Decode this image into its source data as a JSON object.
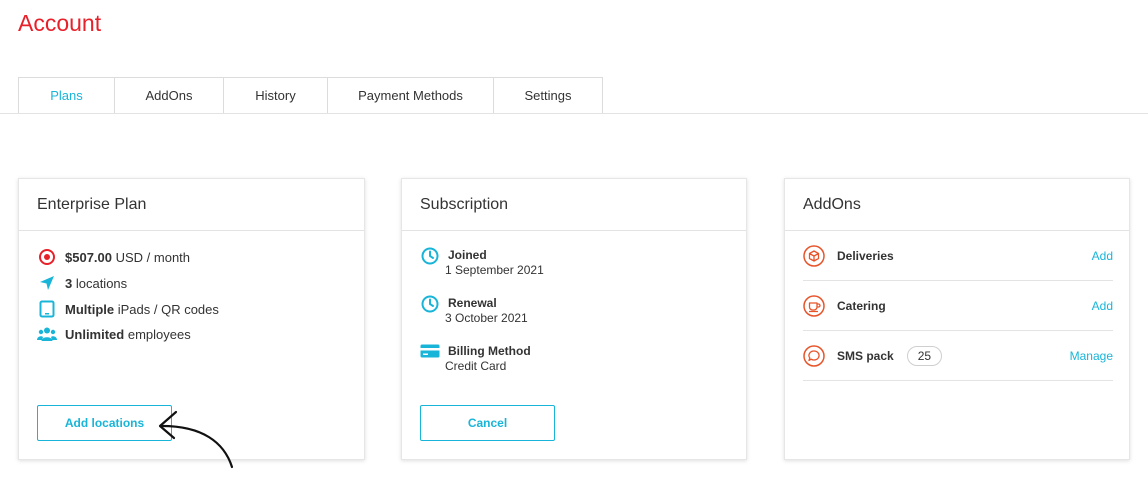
{
  "page": {
    "title": "Account"
  },
  "tabs": [
    {
      "label": "Plans",
      "active": true
    },
    {
      "label": "AddOns"
    },
    {
      "label": "History"
    },
    {
      "label": "Payment Methods"
    },
    {
      "label": "Settings"
    }
  ],
  "plan": {
    "title": "Enterprise Plan",
    "price_bold": "$507.00",
    "price_rest": " USD / month",
    "locations_bold": "3",
    "locations_rest": " locations",
    "devices_bold": "Multiple",
    "devices_rest": " iPads / QR codes",
    "employees_bold": "Unlimited",
    "employees_rest": " employees",
    "button": "Add locations"
  },
  "subscription": {
    "title": "Subscription",
    "items": [
      {
        "label": "Joined",
        "value": "1 September 2021",
        "icon": "clock-icon"
      },
      {
        "label": "Renewal",
        "value": "3 October 2021",
        "icon": "clock-icon"
      },
      {
        "label": "Billing Method",
        "value": "Credit Card",
        "icon": "credit-card-icon"
      }
    ],
    "button": "Cancel"
  },
  "addons": {
    "title": "AddOns",
    "items": [
      {
        "name": "Deliveries",
        "action": "Add",
        "icon": "box-icon"
      },
      {
        "name": "Catering",
        "action": "Add",
        "icon": "cup-icon"
      },
      {
        "name": "SMS pack",
        "count": "25",
        "action": "Manage",
        "icon": "chat-icon"
      }
    ]
  },
  "colors": {
    "brand_red": "#e8202a",
    "accent": "#19b5d8",
    "addon_icon": "#e8542a"
  }
}
